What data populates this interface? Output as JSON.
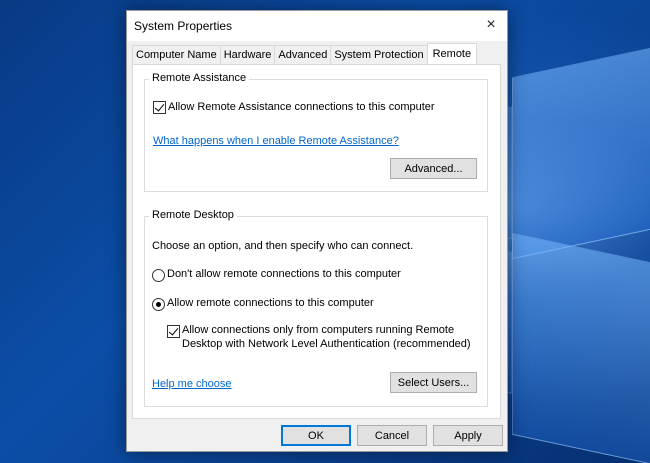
{
  "window": {
    "title": "System Properties",
    "close_icon": "×"
  },
  "tabs": [
    {
      "label": "Computer Name"
    },
    {
      "label": "Hardware"
    },
    {
      "label": "Advanced"
    },
    {
      "label": "System Protection"
    },
    {
      "label": "Remote",
      "active": true
    }
  ],
  "remote_assistance": {
    "group_title": "Remote Assistance",
    "allow_checkbox": {
      "label": "Allow Remote Assistance connections to this computer",
      "checked": true
    },
    "help_link": "What happens when I enable Remote Assistance?",
    "advanced_button": "Advanced..."
  },
  "remote_desktop": {
    "group_title": "Remote Desktop",
    "instructions": "Choose an option, and then specify who can connect.",
    "options": [
      {
        "label": "Don't allow remote connections to this computer",
        "selected": false
      },
      {
        "label": "Allow remote connections to this computer",
        "selected": true
      }
    ],
    "nla_checkbox": {
      "line1": "Allow connections only from computers running Remote",
      "line2": "Desktop with Network Level Authentication (recommended)",
      "checked": true
    },
    "help_link": "Help me choose",
    "select_users_button": "Select Users..."
  },
  "footer": {
    "ok_label": "OK",
    "cancel_label": "Cancel",
    "apply_label": "Apply"
  },
  "colors": {
    "link": "#0066cc",
    "accent": "#0078d7",
    "desktop": "#0a3f86"
  }
}
